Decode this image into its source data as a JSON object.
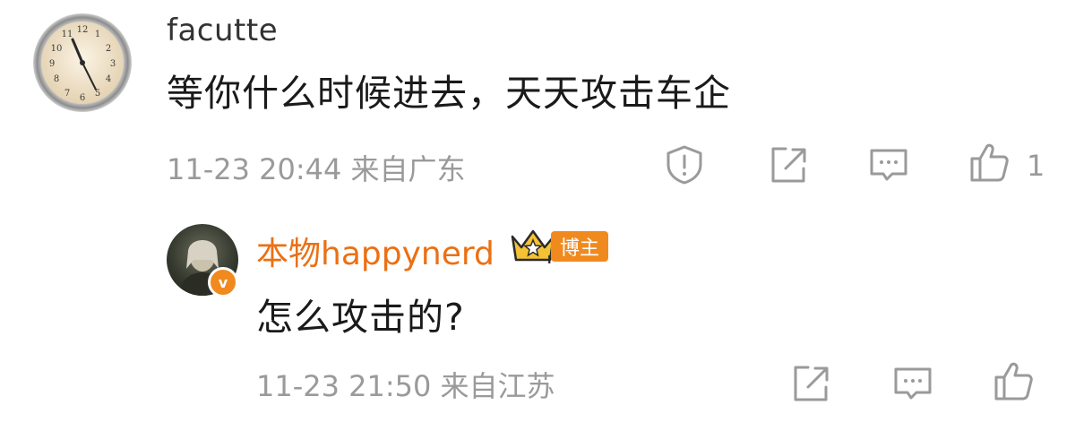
{
  "comment": {
    "username": "facutte",
    "text": "等你什么时候进去，天天攻击车企",
    "meta": "11-23 20:44 来自广东",
    "like_count": "1",
    "icons": [
      "report-icon",
      "share-icon",
      "comment-icon",
      "like-icon"
    ],
    "clock_numerals": [
      "12",
      "1",
      "2",
      "3",
      "4",
      "5",
      "6",
      "7",
      "8",
      "9",
      "10",
      "11"
    ]
  },
  "reply": {
    "username": "本物happynerd",
    "badge": "博主",
    "crown_numeral": "I",
    "verify_mark": "v",
    "text": "怎么攻击的?",
    "meta": "11-23 21:50 来自江苏",
    "icons": [
      "share-icon",
      "comment-icon",
      "like-icon"
    ]
  },
  "colors": {
    "accent": "#eb7014",
    "muted": "#9a9a9a",
    "text": "#1a1a1a",
    "badge": "#f08a1f"
  }
}
